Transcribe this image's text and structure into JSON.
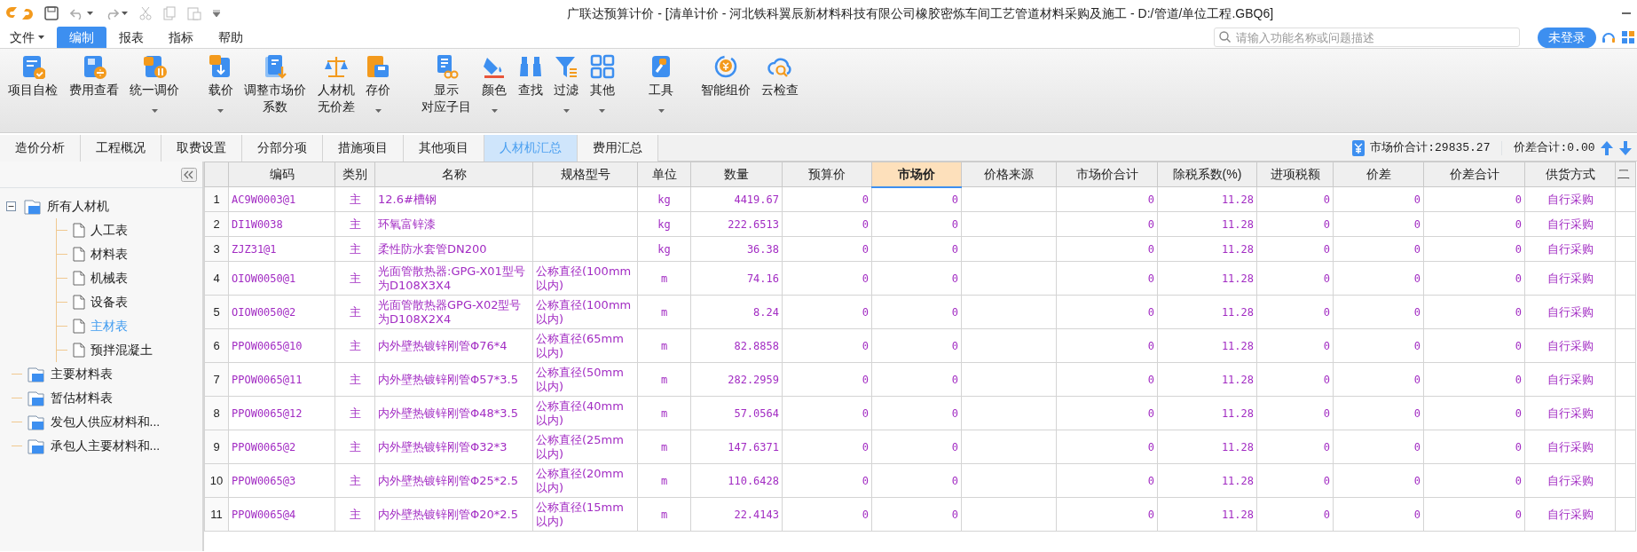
{
  "window": {
    "title": "广联达预算计价 - [清单计价 - 河北铁科翼辰新材料科技有限公司橡胶密炼车间工艺管道材料采购及施工 - D:/管道/单位工程.GBQ6]"
  },
  "menu": [
    {
      "label": "文件",
      "dropdown": true,
      "selected": false
    },
    {
      "label": "编制",
      "dropdown": false,
      "selected": true
    },
    {
      "label": "报表",
      "dropdown": false,
      "selected": false
    },
    {
      "label": "指标",
      "dropdown": false,
      "selected": false
    },
    {
      "label": "帮助",
      "dropdown": false,
      "selected": false
    }
  ],
  "search": {
    "placeholder": "请输入功能名称或问题描述"
  },
  "login_button": "未登录",
  "ribbon": [
    {
      "label": "项目自检",
      "dropdown": false
    },
    {
      "label": "费用查看",
      "dropdown": false
    },
    {
      "label": "统一调价",
      "dropdown": true
    },
    {
      "label": "载价",
      "dropdown": true
    },
    {
      "lines": [
        "调整市场价",
        "系数"
      ],
      "dropdown": false
    },
    {
      "lines": [
        "人材机",
        "无价差"
      ],
      "dropdown": false
    },
    {
      "label": "存价",
      "dropdown": true
    },
    {
      "lines": [
        "显示",
        "对应子目"
      ],
      "dropdown": false
    },
    {
      "label": "颜色",
      "dropdown": true
    },
    {
      "label": "查找",
      "dropdown": false
    },
    {
      "label": "过滤",
      "dropdown": true
    },
    {
      "label": "其他",
      "dropdown": true
    },
    {
      "label": "工具",
      "dropdown": true
    },
    {
      "label": "智能组价",
      "dropdown": false
    },
    {
      "label": "云检查",
      "dropdown": false
    }
  ],
  "tabs": [
    {
      "label": "造价分析",
      "selected": false
    },
    {
      "label": "工程概况",
      "selected": false
    },
    {
      "label": "取费设置",
      "selected": false
    },
    {
      "label": "分部分项",
      "selected": false
    },
    {
      "label": "措施项目",
      "selected": false
    },
    {
      "label": "其他项目",
      "selected": false
    },
    {
      "label": "人材机汇总",
      "selected": true
    },
    {
      "label": "费用汇总",
      "selected": false
    }
  ],
  "summary": {
    "market_total": "市场价合计:29835.27",
    "diff_total": "价差合计:0.00"
  },
  "sidebar": {
    "items": [
      {
        "label": "所有人材机",
        "expanded": true,
        "selected": false,
        "children": [
          {
            "label": "人工表",
            "selected": false
          },
          {
            "label": "材料表",
            "selected": false
          },
          {
            "label": "机械表",
            "selected": false
          },
          {
            "label": "设备表",
            "selected": false
          },
          {
            "label": "主材表",
            "selected": true
          },
          {
            "label": "预拌混凝土",
            "selected": false
          }
        ]
      },
      {
        "label": "主要材料表",
        "selected": false
      },
      {
        "label": "暂估材料表",
        "selected": false
      },
      {
        "label": "发包人供应材料和...",
        "selected": false
      },
      {
        "label": "承包人主要材料和...",
        "selected": false
      }
    ]
  },
  "table": {
    "columns": [
      {
        "label": "编码",
        "kind": "code",
        "selected": false
      },
      {
        "label": "类别",
        "kind": "type",
        "selected": false
      },
      {
        "label": "名称",
        "kind": "text",
        "selected": false
      },
      {
        "label": "规格型号",
        "kind": "text",
        "selected": false
      },
      {
        "label": "单位",
        "kind": "unit",
        "selected": false
      },
      {
        "label": "数量",
        "kind": "number",
        "selected": false
      },
      {
        "label": "预算价",
        "kind": "number",
        "selected": false
      },
      {
        "label": "市场价",
        "kind": "number",
        "selected": true
      },
      {
        "label": "价格来源",
        "kind": "text",
        "selected": false
      },
      {
        "label": "市场价合计",
        "kind": "number",
        "selected": false
      },
      {
        "label": "除税系数(%)",
        "kind": "number",
        "selected": false
      },
      {
        "label": "进项税额",
        "kind": "number",
        "selected": false
      },
      {
        "label": "价差",
        "kind": "number",
        "selected": false
      },
      {
        "label": "价差合计",
        "kind": "number",
        "selected": false
      },
      {
        "label": "供货方式",
        "kind": "method",
        "selected": false
      },
      {
        "label": "二",
        "kind": "text",
        "selected": false
      }
    ],
    "rows": [
      {
        "number": "1",
        "cells": [
          "AC9W0003@1",
          "主",
          "12.6#槽钢",
          null,
          "kg",
          "4419.67",
          "0",
          "0",
          null,
          "0",
          "11.28",
          "0",
          "0",
          "0",
          "自行采购",
          null
        ]
      },
      {
        "number": "2",
        "cells": [
          "DI1W0038",
          "主",
          "环氧富锌漆",
          null,
          "kg",
          "222.6513",
          "0",
          "0",
          null,
          "0",
          "11.28",
          "0",
          "0",
          "0",
          "自行采购",
          null
        ]
      },
      {
        "number": "3",
        "cells": [
          "ZJZ31@1",
          "主",
          "柔性防水套管DN200",
          null,
          "kg",
          "36.38",
          "0",
          "0",
          null,
          "0",
          "11.28",
          "0",
          "0",
          "0",
          "自行采购",
          null
        ]
      },
      {
        "number": "4",
        "cells": [
          "OIOW0050@1",
          "主",
          "光面管散热器:GPG-X01型号为D108X3X4",
          "公称直径(100mm以内)",
          "m",
          "74.16",
          "0",
          "0",
          null,
          "0",
          "11.28",
          "0",
          "0",
          "0",
          "自行采购",
          null
        ]
      },
      {
        "number": "5",
        "cells": [
          "OIOW0050@2",
          "主",
          "光面管散热器GPG-X02型号为D108X2X4",
          "公称直径(100mm以内)",
          "m",
          "8.24",
          "0",
          "0",
          null,
          "0",
          "11.28",
          "0",
          "0",
          "0",
          "自行采购",
          null
        ]
      },
      {
        "number": "6",
        "cells": [
          "PPOW0065@10",
          "主",
          "内外壁热镀锌刚管Φ76*4",
          "公称直径(65mm以内)",
          "m",
          "82.8858",
          "0",
          "0",
          null,
          "0",
          "11.28",
          "0",
          "0",
          "0",
          "自行采购",
          null
        ]
      },
      {
        "number": "7",
        "cells": [
          "PPOW0065@11",
          "主",
          "内外壁热镀锌刚管Φ57*3.5",
          "公称直径(50mm以内)",
          "m",
          "282.2959",
          "0",
          "0",
          null,
          "0",
          "11.28",
          "0",
          "0",
          "0",
          "自行采购",
          null
        ]
      },
      {
        "number": "8",
        "cells": [
          "PPOW0065@12",
          "主",
          "内外壁热镀锌刚管Φ48*3.5",
          "公称直径(40mm以内)",
          "m",
          "57.0564",
          "0",
          "0",
          null,
          "0",
          "11.28",
          "0",
          "0",
          "0",
          "自行采购",
          null
        ]
      },
      {
        "number": "9",
        "cells": [
          "PPOW0065@2",
          "主",
          "内外壁热镀锌刚管Φ32*3",
          "公称直径(25mm以内)",
          "m",
          "147.6371",
          "0",
          "0",
          null,
          "0",
          "11.28",
          "0",
          "0",
          "0",
          "自行采购",
          null
        ]
      },
      {
        "number": "10",
        "cells": [
          "PPOW0065@3",
          "主",
          "内外壁热镀锌刚管Φ25*2.5",
          "公称直径(20mm以内)",
          "m",
          "110.6428",
          "0",
          "0",
          null,
          "0",
          "11.28",
          "0",
          "0",
          "0",
          "自行采购",
          null
        ]
      },
      {
        "number": "11",
        "cells": [
          "PPOW0065@4",
          "主",
          "内外壁热镀锌刚管Φ20*2.5",
          "公称直径(15mm以内)",
          "m",
          "22.4143",
          "0",
          "0",
          null,
          "0",
          "11.28",
          "0",
          "0",
          "0",
          "自行采购",
          null
        ]
      }
    ]
  }
}
